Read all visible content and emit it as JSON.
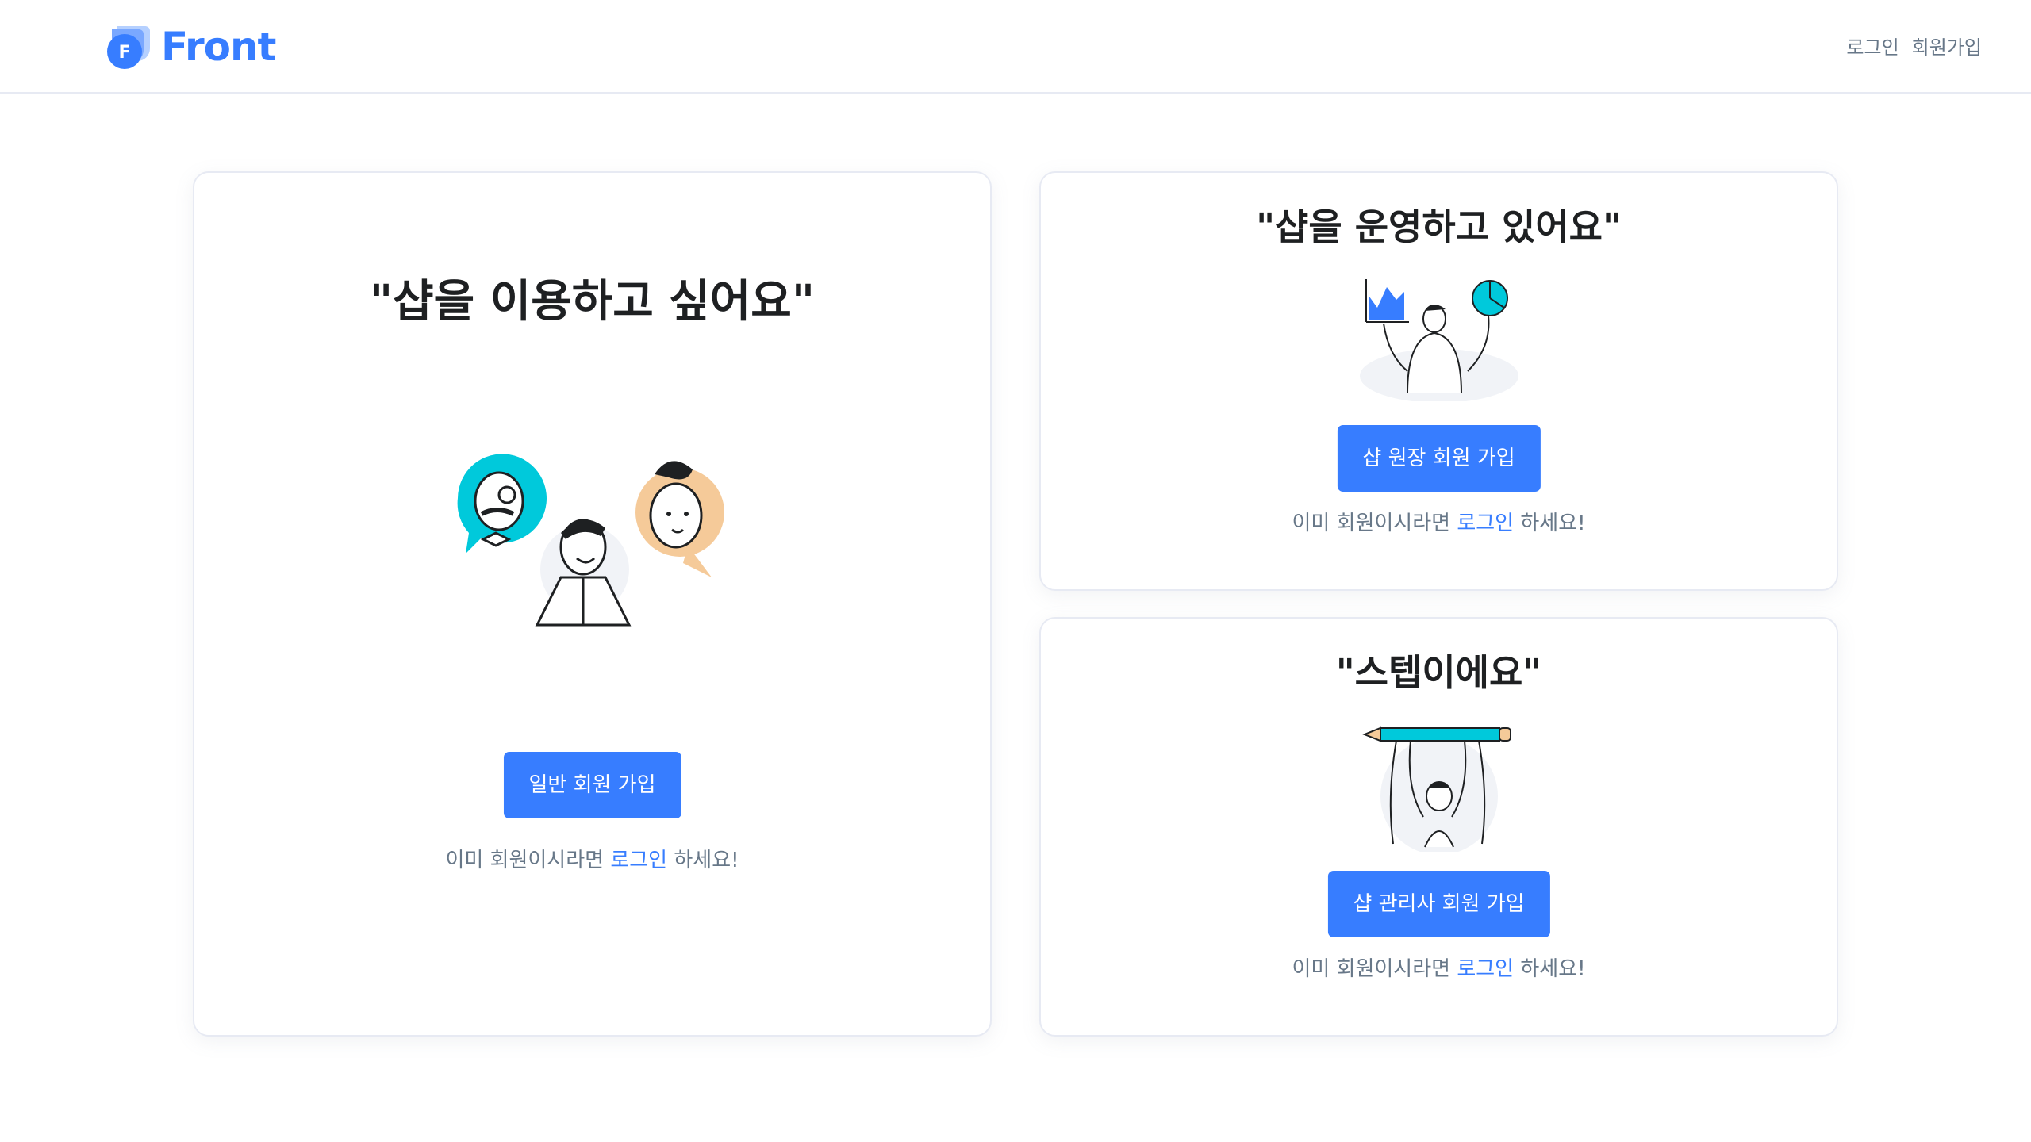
{
  "header": {
    "brand": "Front",
    "brand_initial": "F",
    "nav": {
      "login": "로그인",
      "signup": "회원가입"
    }
  },
  "cards": {
    "customer": {
      "title": "\"샵을 이용하고 싶어요\"",
      "button": "일반 회원 가입",
      "login_prefix": "이미 회원이시라면",
      "login_link": "로그인",
      "login_suffix": "하세요!"
    },
    "owner": {
      "title": "\"샵을 운영하고 있어요\"",
      "button": "샵 원장 회원 가입",
      "login_prefix": "이미 회원이시라면",
      "login_link": "로그인",
      "login_suffix": "하세요!"
    },
    "staff": {
      "title": "\"스텝이에요\"",
      "button": "샵 관리사 회원 가입",
      "login_prefix": "이미 회원이시라면",
      "login_link": "로그인",
      "login_suffix": "하세요!"
    }
  },
  "colors": {
    "primary": "#377dff",
    "text_muted": "#677788",
    "teal": "#00c9db",
    "peach": "#f5ca99"
  }
}
